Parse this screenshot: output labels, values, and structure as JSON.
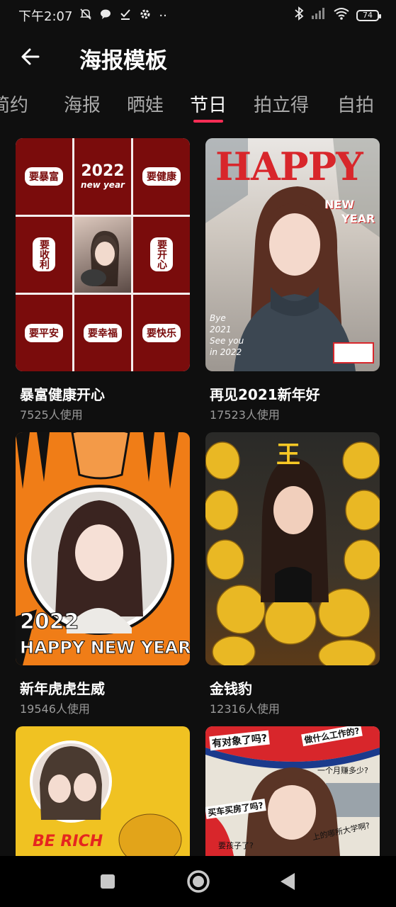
{
  "status_bar": {
    "time": "下午2:07",
    "dots": "··",
    "battery": "74"
  },
  "header": {
    "title": "海报模板"
  },
  "tabs": [
    {
      "label": "简约",
      "active": false
    },
    {
      "label": "海报",
      "active": false
    },
    {
      "label": "晒娃",
      "active": false
    },
    {
      "label": "节日",
      "active": true
    },
    {
      "label": "拍立得",
      "active": false
    },
    {
      "label": "自拍",
      "active": false
    }
  ],
  "colors": {
    "accent": "#ff2d55",
    "background": "#0f0f0f"
  },
  "cards": [
    {
      "title": "暴富健康开心",
      "usage": "7525人使用",
      "poster": {
        "year": "2022",
        "sub": "new year",
        "stickers": [
          "要暴富",
          "要健康",
          "要收利",
          "要开心",
          "要平安",
          "要幸福",
          "要快乐"
        ]
      }
    },
    {
      "title": "再见2021新年好",
      "usage": "17523人使用",
      "poster": {
        "headline": "HAPPY",
        "line2": "NEW",
        "line3": "YEAR",
        "note": [
          "Bye",
          "2021",
          "See you",
          "in 2022"
        ]
      }
    },
    {
      "title": "新年虎虎生威",
      "usage": "19546人使用",
      "poster": {
        "year": "2022",
        "headline": "HAPPY NEW YEAR"
      }
    },
    {
      "title": "金钱豹",
      "usage": "12316人使用",
      "poster": {
        "mark": "王"
      }
    },
    {
      "title": "",
      "usage": "",
      "poster": {
        "headline": "BE RICH"
      }
    },
    {
      "title": "",
      "usage": "",
      "poster": {
        "bubbles": [
          "有对象了吗?",
          "做什么工作的?",
          "一个月赚多少?",
          "买车买房了吗?",
          "上的哪所大学啊?",
          "要孩子了?"
        ]
      }
    }
  ]
}
